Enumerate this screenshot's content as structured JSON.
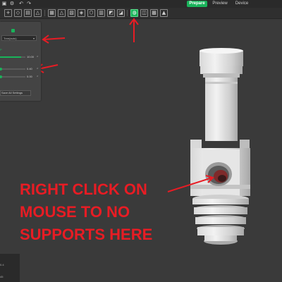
{
  "topbar": {
    "modes": [
      "Prepare",
      "Preview",
      "Device"
    ],
    "active_mode": "Prepare",
    "accent_color": "#19b35a",
    "system_icons": [
      "file-icon",
      "gear-icon",
      "undo-icon",
      "redo-icon"
    ]
  },
  "toolbar": {
    "tools": [
      "add-icon",
      "orient-icon",
      "arrange-icon",
      "lay-on-face-icon",
      "scale-icon",
      "mirror-icon",
      "cut-icon",
      "seam-icon",
      "measure-icon",
      "assemble-icon",
      "paint-supports-icon",
      "variable-layer-icon",
      "color-paint-icon",
      "support-painting-icon",
      "text-icon"
    ],
    "active_tool": "paint-supports-icon"
  },
  "panel": {
    "select_value": "Tree(auto)",
    "values": [
      "10.00",
      "0.40",
      "0.00"
    ],
    "button_label": "Save All Settings"
  },
  "bottom": {
    "lines": [
      "0.4",
      "45"
    ]
  },
  "annotation": {
    "lines": [
      "RIGHT CLICK ON",
      "MOUSE TO NO",
      "SUPPORTS HERE"
    ],
    "color": "#e81c24"
  }
}
